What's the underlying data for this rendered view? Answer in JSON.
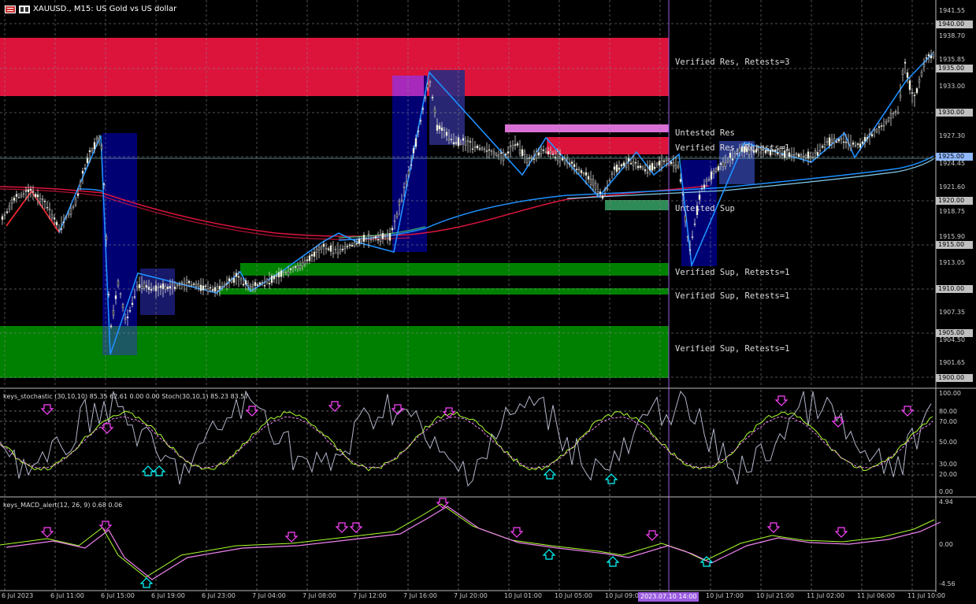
{
  "window": {
    "symbol_title": "XAUUSD., M15:  US Gold vs US dollar"
  },
  "zones": {
    "verified_res_top": "Verified Res, Retests=3",
    "untested_res": "Untested Res",
    "verified_res_mid": "Verified Res, Retests=1",
    "untested_sup": "Untested Sup",
    "verified_sup_1": "Verified Sup, Retests=1",
    "verified_sup_2": "Verified Sup, Retests=1",
    "verified_sup_3": "Verified Sup, Retests=1"
  },
  "price_axis": {
    "labels": [
      "1941.55",
      "1938.70",
      "1935.85",
      "1933.00",
      "1927.30",
      "1924.45",
      "1921.60",
      "1918.75",
      "1915.90",
      "1913.05",
      "1907.35",
      "1904.50",
      "1901.65"
    ],
    "boxed": [
      "1940.00",
      "1935.00",
      "1930.00",
      "1925.00",
      "1920.00",
      "1915.00",
      "1910.00",
      "1905.00",
      "1900.00"
    ],
    "current_price": "1925.00"
  },
  "stoch_panel": {
    "header": "keys_stochastic (30,10,10) 85.35 62.61 0.00 0.00  Stoch(30,10,1) 85.23 83.57",
    "levels": [
      "100.00",
      "80.00",
      "70.00",
      "50.00",
      "30.00",
      "20.00",
      "0.00"
    ]
  },
  "macd_panel": {
    "header": "keys_MACD_alert(12, 26, 9) 0.68 0.06",
    "levels": [
      "4.94",
      "0.00",
      "-4.56"
    ]
  },
  "time_axis": {
    "labels": [
      "6 Jul 2023",
      "6 Jul 11:00",
      "6 Jul 15:00",
      "6 Jul 19:00",
      "6 Jul 23:00",
      "7 Jul 04:00",
      "7 Jul 08:00",
      "7 Jul 12:00",
      "7 Jul 16:00",
      "7 Jul 20:00",
      "10 Jul 01:00",
      "10 Jul 05:00",
      "10 Jul 09:00",
      "10 Jul 17:00",
      "10 Jul 21:00",
      "11 Jul 02:00",
      "11 Jul 06:00",
      "11 Jul 10:00"
    ],
    "cursor_time": "2023.07.10 14:00"
  },
  "colors": {
    "res_zone": "#dc143c",
    "sup_zone": "#008000",
    "untested_res": "#da70d6",
    "untested_sup": "#2e8b57",
    "box_fill": "#000080",
    "ma_blue": "#1e90ff",
    "ma_red": "#dc143c",
    "cursor": "#9a5be0"
  }
}
